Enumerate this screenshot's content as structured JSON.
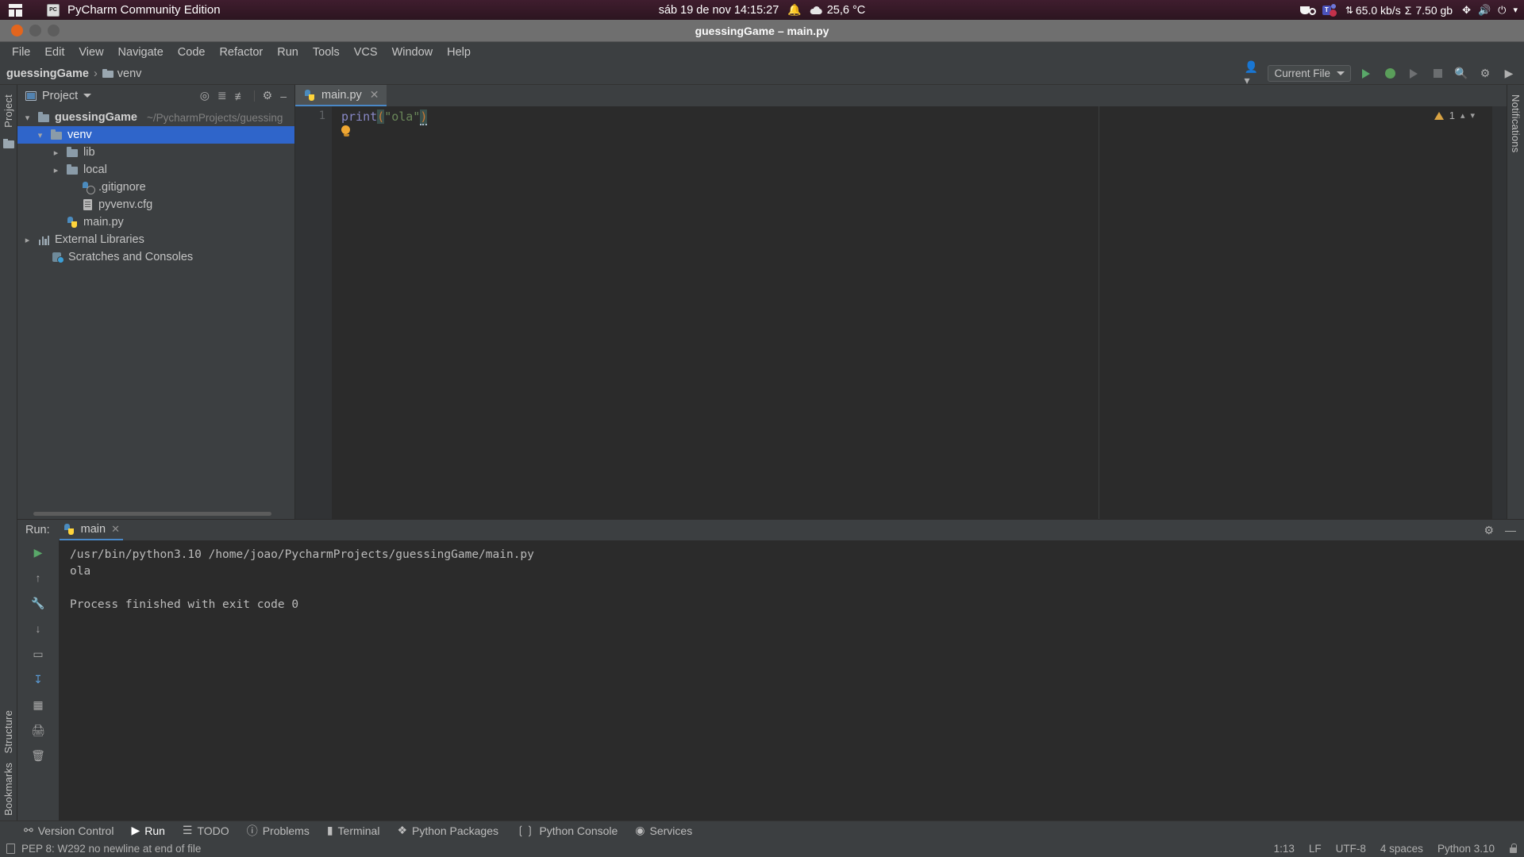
{
  "os_panel": {
    "app_menu_icon": "ubuntu-apps-icon",
    "app_icon_label": "PC",
    "app_title": "PyCharm Community Edition",
    "clock": "sáb 19 de nov  14:15:27",
    "bell_icon": "notification-bell-icon",
    "weather_icon": "cloud-icon",
    "temperature": "25,6 °C",
    "tray": {
      "coffee_icon": "coffee-cup-icon",
      "teams_icon": "teams-icon",
      "teams_letter": "T",
      "net_arrows": "⇅",
      "net_speed": "65.0 kb/s",
      "sigma": "Σ",
      "data_total": "7.50 gb",
      "bluetooth_icon": "bluetooth-icon",
      "volume_icon": "volume-icon",
      "power_icon": "power-icon",
      "chevron_icon": "chevron-down-icon"
    }
  },
  "window": {
    "title": "guessingGame – main.py",
    "buttons": {
      "close": "close-button",
      "minimize": "minimize-button",
      "maximize": "maximize-button"
    }
  },
  "menubar": [
    {
      "label": "File",
      "mnemonic": "F"
    },
    {
      "label": "Edit",
      "mnemonic": "E"
    },
    {
      "label": "View",
      "mnemonic": "V"
    },
    {
      "label": "Navigate",
      "mnemonic": "N"
    },
    {
      "label": "Code",
      "mnemonic": "C"
    },
    {
      "label": "Refactor",
      "mnemonic": "R"
    },
    {
      "label": "Run",
      "mnemonic": "u"
    },
    {
      "label": "Tools",
      "mnemonic": "T"
    },
    {
      "label": "VCS",
      "mnemonic": "S"
    },
    {
      "label": "Window",
      "mnemonic": "W"
    },
    {
      "label": "Help",
      "mnemonic": "H"
    }
  ],
  "navbar": {
    "breadcrumbs": [
      {
        "label": "guessingGame",
        "bold": true
      },
      {
        "label": "venv",
        "bold": false
      }
    ],
    "account_icon": "account-icon",
    "run_config": "Current File",
    "run_button": "run-button",
    "debug_button": "debug-button",
    "run_coverage_button": "run-with-coverage-button",
    "stop_button": "stop-button",
    "search_button": "search-everywhere-icon",
    "settings_button": "settings-gear-icon",
    "updates_button": "ide-update-icon"
  },
  "left_rail": {
    "project_label": "Project",
    "structure_label": "Structure",
    "bookmarks_label": "Bookmarks"
  },
  "right_rail": {
    "notifications_label": "Notifications"
  },
  "project_panel": {
    "title": "Project",
    "window_icon": "project-window-icon",
    "dropdown_icon": "chevron-down-icon",
    "actions": {
      "locate_icon": "select-opened-file-icon",
      "expand_icon": "expand-all-icon",
      "collapse_icon": "collapse-all-icon",
      "settings_icon": "gear-icon",
      "hide_icon": "hide-icon"
    },
    "tree": [
      {
        "label": "guessingGame",
        "path": "~/PycharmProjects/guessing",
        "icon": "folder-icon",
        "twist": "expanded",
        "indent": 0,
        "bold": true,
        "selected": false
      },
      {
        "label": "venv",
        "path": "",
        "icon": "folder-icon",
        "twist": "expanded",
        "indent": 1,
        "bold": false,
        "selected": true
      },
      {
        "label": "lib",
        "path": "",
        "icon": "folder-icon",
        "twist": "collapsed",
        "indent": 2,
        "bold": false,
        "selected": false
      },
      {
        "label": "local",
        "path": "",
        "icon": "folder-icon",
        "twist": "collapsed",
        "indent": 2,
        "bold": false,
        "selected": false
      },
      {
        "label": ".gitignore",
        "path": "",
        "icon": "python-ignored-icon",
        "twist": "none",
        "indent": 3,
        "bold": false,
        "selected": false
      },
      {
        "label": "pyvenv.cfg",
        "path": "",
        "icon": "config-file-icon",
        "twist": "none",
        "indent": 3,
        "bold": false,
        "selected": false
      },
      {
        "label": "main.py",
        "path": "",
        "icon": "python-file-icon",
        "twist": "none",
        "indent": 2,
        "bold": false,
        "selected": false
      },
      {
        "label": "External Libraries",
        "path": "",
        "icon": "libraries-icon",
        "twist": "collapsed",
        "indent": 0,
        "bold": false,
        "selected": false
      },
      {
        "label": "Scratches and Consoles",
        "path": "",
        "icon": "scratches-icon",
        "twist": "none",
        "indent": 0,
        "bold": false,
        "selected": false
      }
    ]
  },
  "editor": {
    "tab": {
      "label": "main.py",
      "icon": "python-file-icon",
      "close_icon": "close-icon"
    },
    "line_numbers": [
      "1"
    ],
    "code": {
      "func": "print",
      "open_paren": "(",
      "string": "\"ola\"",
      "close_paren": ")"
    },
    "intention_bulb_icon": "intention-bulb-icon",
    "inspection": {
      "warning_icon": "warning-triangle-icon",
      "warning_count": "1",
      "up_icon": "chevron-up-icon",
      "down_icon": "chevron-down-icon"
    }
  },
  "run_window": {
    "title": "Run:",
    "tab_label": "main",
    "tab_icon": "python-icon",
    "tab_close_icon": "close-icon",
    "actions": {
      "settings_icon": "gear-icon",
      "hide_icon": "hide-icon"
    },
    "side_buttons": [
      "rerun-button",
      "scroll-up-button",
      "stop-button",
      "scroll-down-button",
      "soft-wrap-button",
      "print-button",
      "trash-button"
    ],
    "console_lines": [
      "/usr/bin/python3.10 /home/joao/PycharmProjects/guessingGame/main.py",
      "ola",
      "",
      "Process finished with exit code 0"
    ]
  },
  "tool_strip": [
    {
      "label": "Version Control",
      "icon": "branch-icon",
      "active": false
    },
    {
      "label": "Run",
      "icon": "run-icon",
      "active": true
    },
    {
      "label": "TODO",
      "icon": "todo-icon",
      "active": false
    },
    {
      "label": "Problems",
      "icon": "problems-icon",
      "active": false
    },
    {
      "label": "Terminal",
      "icon": "terminal-icon",
      "active": false
    },
    {
      "label": "Python Packages",
      "icon": "packages-icon",
      "active": false
    },
    {
      "label": "Python Console",
      "icon": "python-console-icon",
      "active": false
    },
    {
      "label": "Services",
      "icon": "services-icon",
      "active": false
    }
  ],
  "statusbar": {
    "message_icon": "event-log-icon",
    "message": "PEP 8: W292 no newline at end of file",
    "caret": "1:13",
    "line_sep": "LF",
    "encoding": "UTF-8",
    "indent": "4 spaces",
    "interpreter": "Python 3.10",
    "lock_icon": "read-only-lock-icon"
  }
}
